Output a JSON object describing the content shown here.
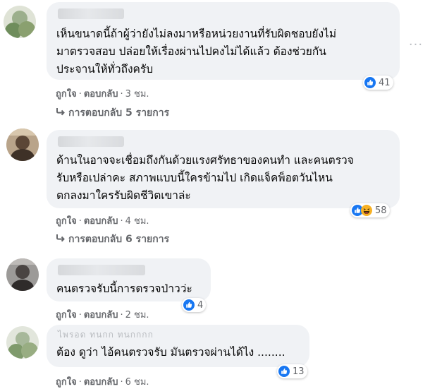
{
  "comments": [
    {
      "author_blurred": true,
      "text_lines": [
        "เห็นขนาดนี้ถ้าผู้ว่ายังไม่ลงมาหรือหน่วยงานที่รับผิดชอบยังไม่",
        "มาตรวจสอบ ปล่อยให้เรื่องผ่านไปคงไม่ได้แล้ว ต้องช่วยกัน",
        "ประจานให้ทั่วถึงครับ"
      ],
      "like": "ถูกใจ",
      "reply": "ตอบกลับ",
      "time": "3 ชม.",
      "reaction_icon": "like-icon",
      "reaction_count": "41",
      "replies_label": "การตอบกลับ 5 รายการ"
    },
    {
      "author_blurred": true,
      "text_lines": [
        "ด้านในอาจจะเชื่อมถึงกันด้วยแรงศรัทธาของคนทำ และคนตรวจ",
        "รับหรือเปล่าคะ สภาพแบบนี้ใครข้ามไป เกิดแจ็คพ็อตวันไหน",
        "ตกลงมาใครรับผิดชีวิตเขาล่ะ"
      ],
      "like": "ถูกใจ",
      "reply": "ตอบกลับ",
      "time": "4 ชม.",
      "reaction_icon": "like-haha-icon",
      "reaction_count": "58",
      "replies_label": "การตอบกลับ 6 รายการ"
    },
    {
      "author_blurred": true,
      "text_lines": [
        "คนตรวจรับนี้การตรวจป่าวว่ะ"
      ],
      "like": "ถูกใจ",
      "reply": "ตอบกลับ",
      "time": "2 ชม.",
      "reaction_icon": "like-icon",
      "reaction_count": "4"
    },
    {
      "author_name": "ไพรอด ทนกก ทนกกกก",
      "text_lines": [
        "ต้อง ดูว่า ไอ้คนตรวจรับ มันตรวจผ่านได้ไง ........"
      ],
      "like": "ถูกใจ",
      "reply": "ตอบกลับ",
      "time": "6 ชม.",
      "reaction_icon": "like-icon",
      "reaction_count": "13"
    }
  ],
  "colors": {
    "bubble": "#f0f2f5",
    "meta_text": "#65676b",
    "like_blue": "#1877f2",
    "haha_yellow": "#f7b125"
  }
}
